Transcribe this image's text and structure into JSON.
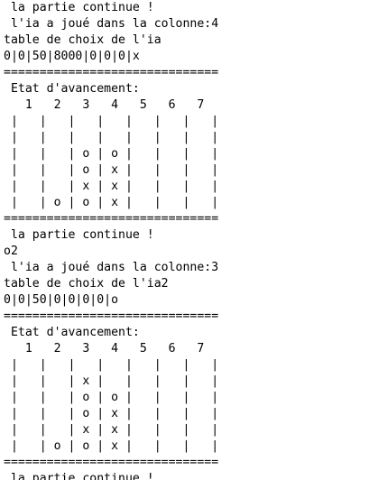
{
  "console": {
    "lines": [
      " la partie continue !",
      " l'ia a joué dans la colonne:4",
      "table de choix de l'ia",
      "0|0|50|8000|0|0|0|x",
      "==============================",
      " Etat d'avancement:",
      "   1   2   3   4   5   6   7",
      " |   |   |   |   |   |   |   |",
      " |   |   |   |   |   |   |   |",
      " |   |   | o | o |   |   |   |",
      " |   |   | o | x |   |   |   |",
      " |   |   | x | x |   |   |   |",
      " |   | o | o | x |   |   |   |",
      "==============================",
      " la partie continue !",
      "o2",
      " l'ia a joué dans la colonne:3",
      "table de choix de l'ia2",
      "0|0|50|0|0|0|0|o",
      "==============================",
      " Etat d'avancement:",
      "   1   2   3   4   5   6   7",
      " |   |   |   |   |   |   |   |",
      " |   |   | x |   |   |   |   |",
      " |   |   | o | o |   |   |   |",
      " |   |   | o | x |   |   |   |",
      " |   |   | x | x |   |   |   |",
      " |   | o | o | x |   |   |   |",
      "==============================",
      " la partie continue !"
    ]
  }
}
